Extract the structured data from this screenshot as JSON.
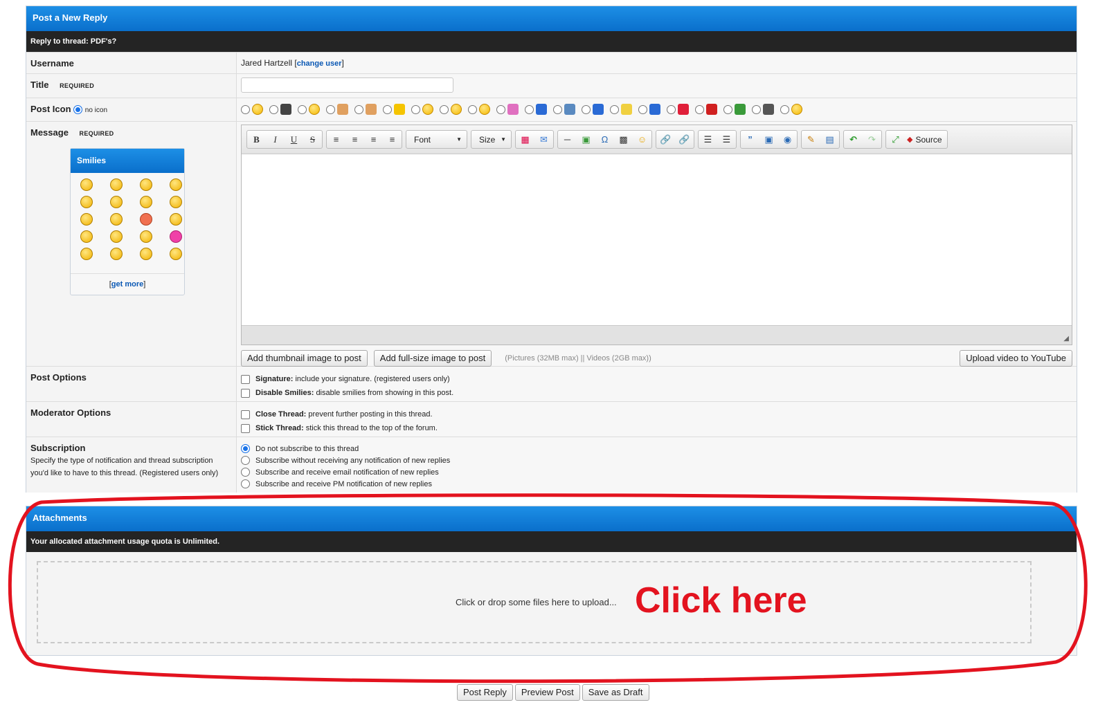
{
  "reply": {
    "heading": "Post a New Reply",
    "subheading": "Reply to thread: PDF's?",
    "username_label": "Username",
    "username_value": "Jared Hartzell",
    "change_user_open": "[",
    "change_user": "change user",
    "change_user_close": "]",
    "title_label": "Title",
    "required": "REQUIRED",
    "title_value": "",
    "post_icon_label": "Post Icon",
    "no_icon": "no icon",
    "message_label": "Message"
  },
  "smilies": {
    "heading": "Smilies",
    "get_more_open": "[",
    "get_more": "get more",
    "get_more_close": "]",
    "icons": [
      "smile",
      "big-grin",
      "cool",
      "grin",
      "tongue",
      "roll-eyes",
      "confused",
      "frown",
      "at",
      "headphones",
      "mad",
      "wink",
      "nerd",
      "smirk",
      "exclaim",
      "heart",
      "question",
      "idea",
      "blush",
      "wink2"
    ]
  },
  "post_icons": [
    "smile",
    "film",
    "grin",
    "thumbs-up",
    "thumbs-down",
    "star",
    "big-grin",
    "frown",
    "wink",
    "rainbow",
    "question",
    "image",
    "music",
    "bulb",
    "info",
    "heart",
    "alert",
    "bug",
    "clapper",
    "laugh"
  ],
  "toolbar": {
    "font": "Font",
    "size": "Size",
    "source": "Source"
  },
  "editor": {
    "add_thumbnail": "Add thumbnail image to post",
    "add_fullsize": "Add full-size image to post",
    "limits": "(Pictures (32MB max) || Videos (2GB max))",
    "upload_youtube": "Upload video to YouTube"
  },
  "post_options": {
    "label": "Post Options",
    "signature_b": "Signature:",
    "signature": "include your signature. (registered users only)",
    "disable_smilies_b": "Disable Smilies:",
    "disable_smilies": "disable smilies from showing in this post."
  },
  "moderator_options": {
    "label": "Moderator Options",
    "close_b": "Close Thread:",
    "close": "prevent further posting in this thread.",
    "stick_b": "Stick Thread:",
    "stick": "stick this thread to the top of the forum."
  },
  "subscription": {
    "label": "Subscription",
    "desc": "Specify the type of notification and thread subscription you'd like to have to this thread. (Registered users only)",
    "options": [
      "Do not subscribe to this thread",
      "Subscribe without receiving any notification of new replies",
      "Subscribe and receive email notification of new replies",
      "Subscribe and receive PM notification of new replies"
    ],
    "selected_index": 0
  },
  "attachments": {
    "heading": "Attachments",
    "quota": "Your allocated attachment usage quota is Unlimited.",
    "drop_text": "Click or drop some files here to upload...",
    "annotation": "Click here",
    "annotation_color": "#e3131f"
  },
  "buttons": {
    "post_reply": "Post Reply",
    "preview": "Preview Post",
    "save_draft": "Save as Draft"
  }
}
